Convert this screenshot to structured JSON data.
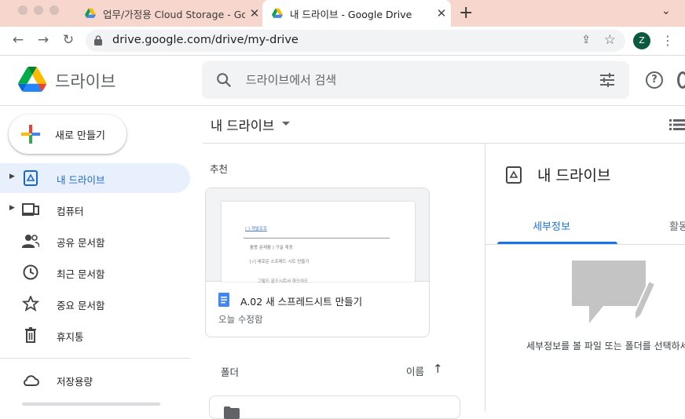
{
  "browser": {
    "tabs": [
      {
        "title": "업무/가정용 Cloud Storage - Goo",
        "active": false
      },
      {
        "title": "내 드라이브 - Google Drive",
        "active": true
      }
    ],
    "new_tab": "+",
    "tab_close": "✕",
    "tab_menu": "⌄",
    "url": "drive.google.com/drive/my-drive",
    "profile_initial": "Z"
  },
  "app": {
    "name": "드라이브",
    "search_placeholder": "드라이브에서 검색",
    "help": "?"
  },
  "sidebar": {
    "new_button": "새로 만들기",
    "items": [
      {
        "label": "내 드라이브",
        "icon": "my-drive-icon",
        "active": true
      },
      {
        "label": "컴퓨터",
        "icon": "computer-icon",
        "active": false
      },
      {
        "label": "공유 문서함",
        "icon": "people-icon",
        "active": false
      },
      {
        "label": "최근 문서함",
        "icon": "clock-icon",
        "active": false
      },
      {
        "label": "중요 문서함",
        "icon": "star-icon",
        "active": false
      },
      {
        "label": "휴지통",
        "icon": "trash-icon",
        "active": false
      },
      {
        "label": "저장용량",
        "icon": "cloud-icon",
        "active": false
      }
    ]
  },
  "main": {
    "breadcrumb": "내 드라이브",
    "suggested_label": "추천",
    "suggested_file": {
      "name": "A.02 새 스프레드시트 만들기",
      "modified": "오늘 수정함",
      "preview_lines": [
        "( ) 개발로로",
        "활용 문제활 ) 구글 계정",
        "[√]  새로운 스프레드 시트 만들기",
        "그렇드 문드시트사 하드아드"
      ]
    },
    "folders_label": "폴더",
    "sort_label": "이름",
    "sort_arrow": "↑"
  },
  "details": {
    "title": "내 드라이브",
    "tab_details": "세부정보",
    "tab_activity": "활동",
    "empty_message": "세부정보를 볼 파일 또는 폴더를 선택하세요"
  },
  "colors": {
    "accent": "#1a73e8",
    "active_nav_bg": "#e8f0fe",
    "titlebar_bg": "#f6d6cd"
  }
}
